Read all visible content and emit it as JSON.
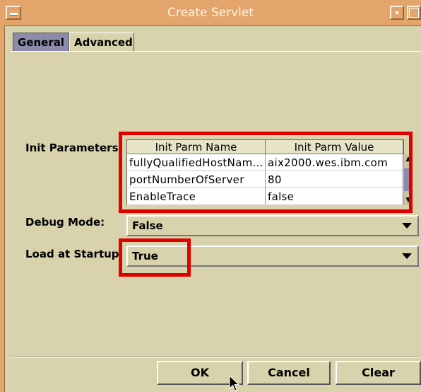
{
  "window": {
    "title": "Create Servlet"
  },
  "tabs": [
    {
      "label": "General"
    },
    {
      "label": "Advanced"
    }
  ],
  "init_params": {
    "label": "Init Parameters:",
    "columns": [
      "Init Parm Name",
      "Init Parm Value"
    ],
    "rows": [
      {
        "name": "fullyQualifiedHostNam...",
        "value": "aix2000.wes.ibm.com"
      },
      {
        "name": "portNumberOfServer",
        "value": "80"
      },
      {
        "name": "EnableTrace",
        "value": "false"
      }
    ]
  },
  "debug_mode": {
    "label": "Debug Mode:",
    "value": "False"
  },
  "load_at_startup": {
    "label": "Load at Startup:",
    "value": "True"
  },
  "buttons": {
    "ok": "OK",
    "cancel": "Cancel",
    "clear": "Clear"
  },
  "colors": {
    "highlight": "#e00000",
    "titlebar": "#e3a56b",
    "background": "#d8d3ad",
    "selected_tab": "#8c8caa"
  },
  "icons": [
    "window-menu-icon",
    "minimize-icon",
    "maximize-icon",
    "dropdown-arrow-icon",
    "mouse-pointer-icon"
  ]
}
